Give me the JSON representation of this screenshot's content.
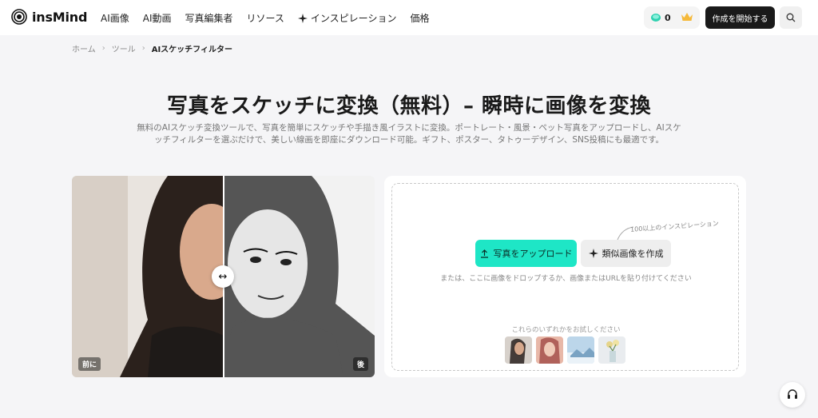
{
  "brand": {
    "name": "insMind"
  },
  "nav": {
    "items": [
      {
        "label": "AI画像"
      },
      {
        "label": "AI動画"
      },
      {
        "label": "写真編集者"
      },
      {
        "label": "リソース"
      },
      {
        "label": "インスピレーション",
        "icon": "sparkle-icon"
      },
      {
        "label": "価格"
      }
    ],
    "credits": "0",
    "start_label": "作成を開始する"
  },
  "breadcrumb": {
    "items": [
      "ホーム",
      "ツール"
    ],
    "current": "AIスケッチフィルター"
  },
  "hero": {
    "title": "写真をスケッチに変換（無料）– 瞬時に画像を変換",
    "subtitle": "無料のAIスケッチ変換ツールで、写真を簡単にスケッチや手描き風イラストに変換。ポートレート・風景・ペット写真をアップロードし、AIスケッチフィルターを選ぶだけで、美しい線画を即座にダウンロード可能。ギフト、ポスター、タトゥーデザイン、SNS投稿にも最適です。"
  },
  "compare": {
    "before_label": "前に",
    "after_label": "後"
  },
  "upload": {
    "inspiration_note": "100以上のインスピレーション",
    "upload_label": "写真をアップロード",
    "similar_label": "類似画像を作成",
    "drop_hint": "または、ここに画像をドロップするか、画像またはURLを貼り付けてください",
    "try_label": "これらのいずれかをお試しください"
  },
  "colors": {
    "accent": "#1ee6c6",
    "dark": "#1a1a1a"
  }
}
